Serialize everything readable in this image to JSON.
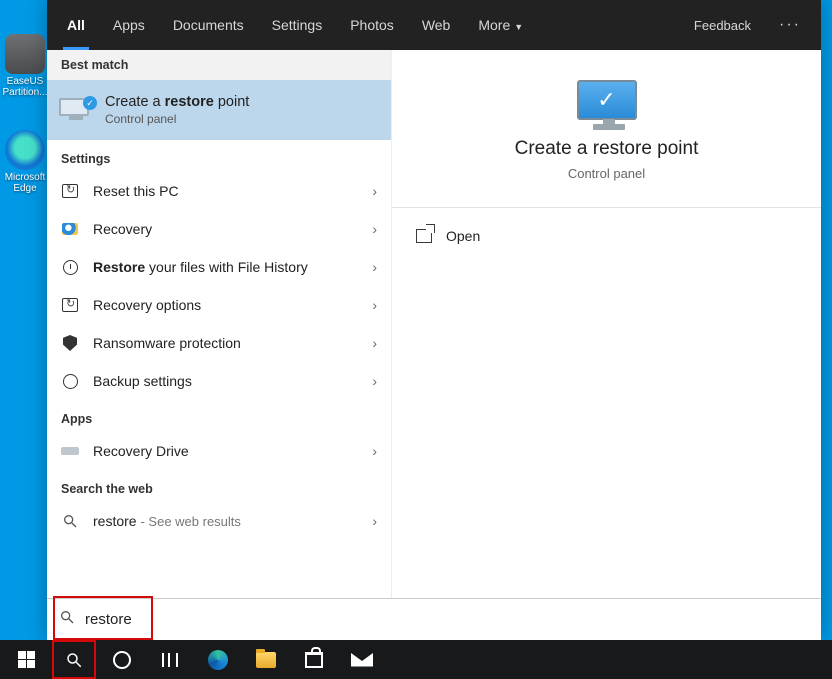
{
  "desktop": {
    "icons": [
      {
        "label": "EaseUS Partition..."
      },
      {
        "label": "Microsoft Edge"
      }
    ]
  },
  "tabs": {
    "items": [
      "All",
      "Apps",
      "Documents",
      "Settings",
      "Photos",
      "Web",
      "More"
    ],
    "active_index": 0,
    "feedback": "Feedback"
  },
  "sections": {
    "best_match": "Best match",
    "settings": "Settings",
    "apps": "Apps",
    "web": "Search the web"
  },
  "best_match": {
    "title_pre": "Create a ",
    "title_bold": "restore",
    "title_post": " point",
    "subtitle": "Control panel"
  },
  "settings_items": [
    {
      "icon": "reset",
      "label": "Reset this PC"
    },
    {
      "icon": "recovery",
      "label": "Recovery"
    },
    {
      "icon": "history",
      "label_pre": "",
      "label_bold": "Restore",
      "label_post": " your files with File History"
    },
    {
      "icon": "reset",
      "label": "Recovery options"
    },
    {
      "icon": "shield",
      "label": "Ransomware protection"
    },
    {
      "icon": "gear",
      "label": "Backup settings"
    }
  ],
  "apps_items": [
    {
      "icon": "drive",
      "label": "Recovery Drive"
    }
  ],
  "web_items": [
    {
      "query": "restore",
      "suffix": "See web results"
    }
  ],
  "preview": {
    "title": "Create a restore point",
    "subtitle": "Control panel",
    "open": "Open"
  },
  "search": {
    "value": "restore"
  }
}
